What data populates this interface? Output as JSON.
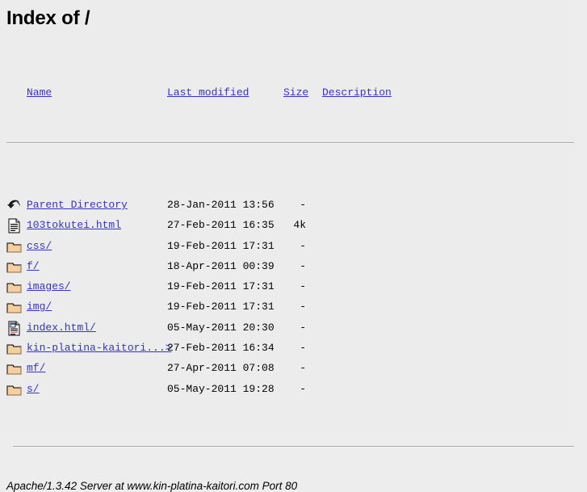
{
  "page": {
    "title": "Index of /",
    "background_color": "#ececec",
    "link_color": "#3333cc",
    "text_color": "#000000"
  },
  "columns": {
    "name": "Name",
    "last_modified": "Last modified",
    "size": "Size",
    "description": "Description"
  },
  "entries": [
    {
      "icon": "parent-directory-icon",
      "name": "Parent Directory",
      "last_modified": "28-Jan-2011 13:56",
      "size": "-",
      "description": ""
    },
    {
      "icon": "text-document-icon",
      "name": "103tokutei.html",
      "last_modified": "27-Feb-2011 16:35",
      "size": "4k",
      "description": ""
    },
    {
      "icon": "folder-icon",
      "name": "css/",
      "last_modified": "19-Feb-2011 17:31",
      "size": "-",
      "description": ""
    },
    {
      "icon": "folder-icon",
      "name": "f/",
      "last_modified": "18-Apr-2011 00:39",
      "size": "-",
      "description": ""
    },
    {
      "icon": "folder-icon",
      "name": "images/",
      "last_modified": "19-Feb-2011 17:31",
      "size": "-",
      "description": ""
    },
    {
      "icon": "folder-icon",
      "name": "img/",
      "last_modified": "19-Feb-2011 17:31",
      "size": "-",
      "description": ""
    },
    {
      "icon": "html-document-icon",
      "name": "index.html/",
      "last_modified": "05-May-2011 20:30",
      "size": "-",
      "description": ""
    },
    {
      "icon": "folder-icon",
      "name": "kin-platina-kaitori...>",
      "last_modified": "27-Feb-2011 16:34",
      "size": "-",
      "description": ""
    },
    {
      "icon": "folder-icon",
      "name": "mf/",
      "last_modified": "27-Apr-2011 07:08",
      "size": "-",
      "description": ""
    },
    {
      "icon": "folder-icon",
      "name": "s/",
      "last_modified": "05-May-2011 19:28",
      "size": "-",
      "description": ""
    }
  ],
  "footer": {
    "text": "Apache/1.3.42 Server at www.kin-platina-kaitori.com Port 80"
  }
}
